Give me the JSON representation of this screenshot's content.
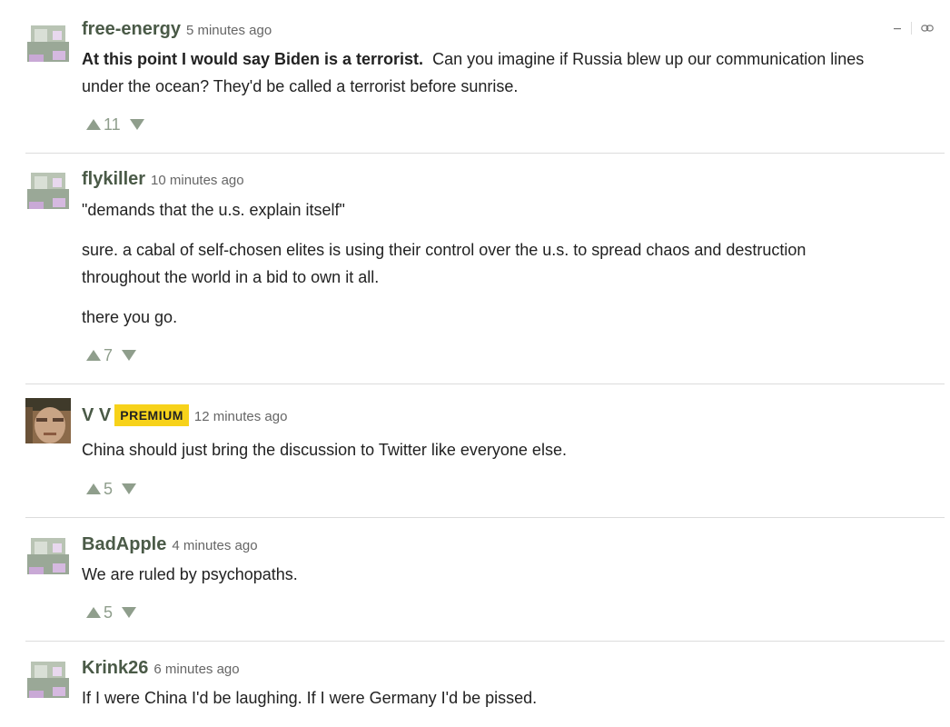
{
  "comments": [
    {
      "author": "free-energy",
      "time": "5 minutes ago",
      "bold_lead": "At this point I would say Biden is a terrorist.",
      "body_lines": [
        "  Can you imagine if Russia blew up our communication lines",
        "under the ocean?  They'd be called a terrorist before sunrise."
      ],
      "upvotes": "11"
    },
    {
      "author": "flykiller",
      "time": "10 minutes ago",
      "paragraphs": [
        "\"demands that the u.s. explain itself\"",
        "sure.  a cabal of self-chosen elites is using their control over the u.s. to spread chaos and destruction",
        "throughout the world in a bid to own it all.",
        "there you go."
      ],
      "upvotes": "7"
    },
    {
      "author": "V V",
      "badge": "PREMIUM",
      "time": "12 minutes ago",
      "text": "China should just bring the discussion to Twitter like everyone else.",
      "upvotes": "5"
    },
    {
      "author": "BadApple",
      "time": "4 minutes ago",
      "text": "We are ruled by psychopaths.",
      "upvotes": "5"
    },
    {
      "author": "Krink26",
      "time": "6 minutes ago",
      "text": "If I were China I'd be laughing. If I were Germany I'd be pissed."
    }
  ],
  "icons": {
    "collapse": "minus-icon",
    "permalink": "link-icon",
    "upvote": "triangle-up-icon",
    "downvote": "triangle-down-icon"
  },
  "colors": {
    "author": "#4a5a47",
    "vote": "#8f9e8c",
    "badge": "#f7d21a",
    "separator": "#dcdcdc"
  }
}
